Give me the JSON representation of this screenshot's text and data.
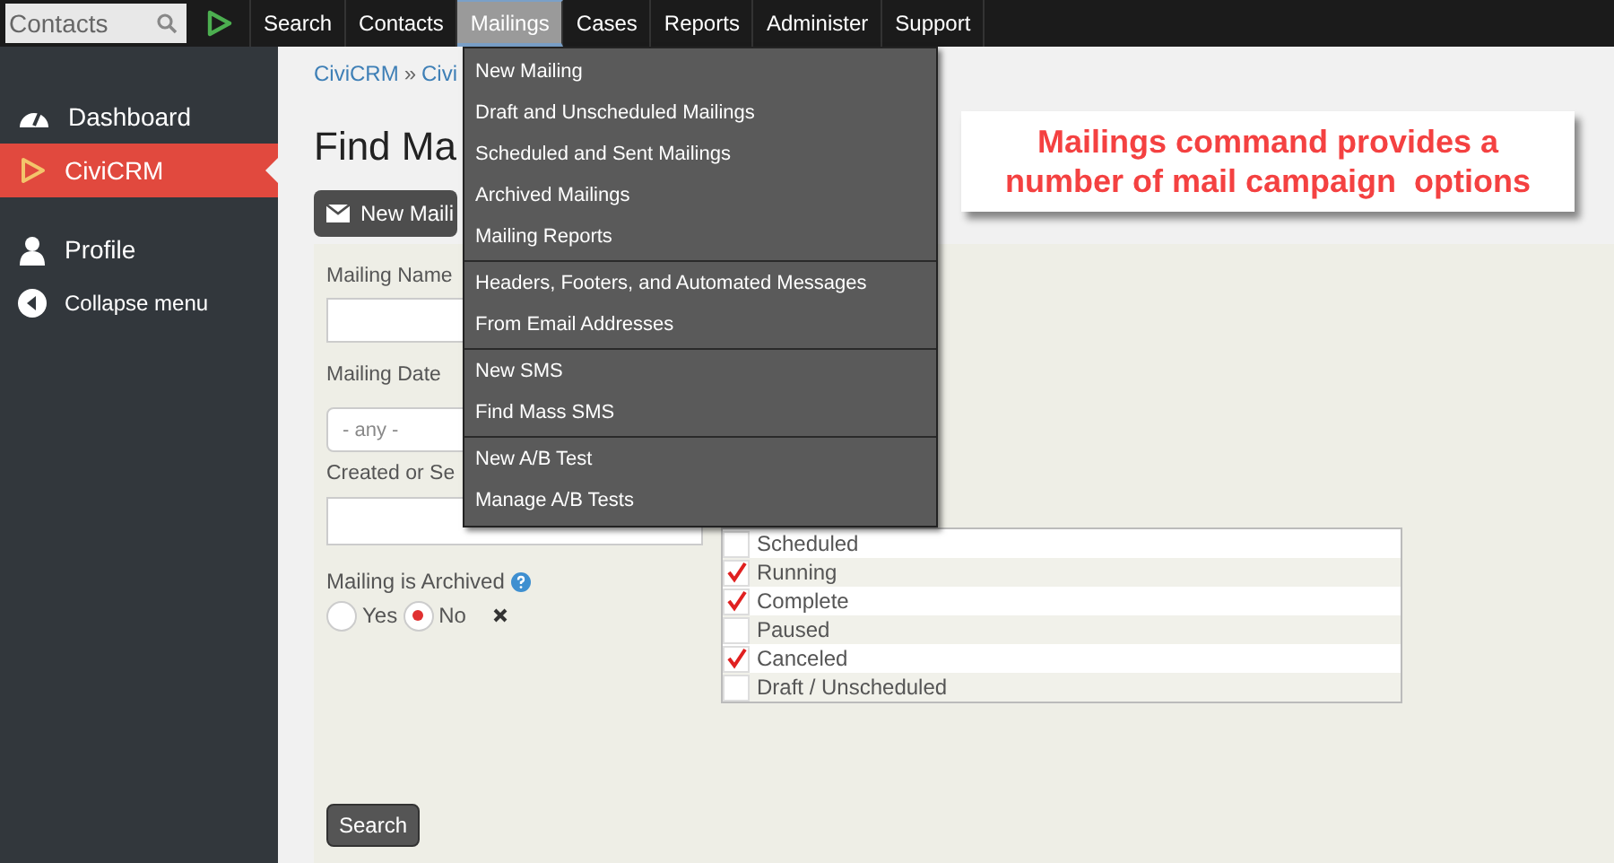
{
  "topbar": {
    "search": {
      "placeholder": "Contacts"
    },
    "nav": [
      {
        "label": "Search",
        "selected": false
      },
      {
        "label": "Contacts",
        "selected": false
      },
      {
        "label": "Mailings",
        "selected": true
      },
      {
        "label": "Cases",
        "selected": false
      },
      {
        "label": "Reports",
        "selected": false
      },
      {
        "label": "Administer",
        "selected": false
      },
      {
        "label": "Support",
        "selected": false
      }
    ]
  },
  "sidebar": {
    "items": [
      {
        "label": "Dashboard",
        "kind": "dashboard",
        "selected": false
      },
      {
        "label": "CiviCRM",
        "kind": "civicrm",
        "selected": true
      },
      {
        "label": "Profile",
        "kind": "profile",
        "selected": false
      },
      {
        "label": "Collapse menu",
        "kind": "collapse",
        "selected": false
      }
    ]
  },
  "page": {
    "breadcrumb": [
      {
        "label": "CiviCRM"
      },
      {
        "label": "Civi"
      }
    ],
    "breadcrumb_separator": "»",
    "title": "Find Ma",
    "new_button": "New Maili",
    "fields": [
      {
        "label": "Mailing Name",
        "kind": "input"
      },
      {
        "label": "Mailing Date",
        "kind": "select",
        "value": "- any -"
      },
      {
        "label": "Created or Se",
        "kind": "wide-input"
      }
    ],
    "archived": {
      "label": "Mailing is Archived",
      "options": [
        {
          "label": "Yes",
          "selected": false
        },
        {
          "label": "No",
          "selected": true
        }
      ]
    },
    "statuses": [
      {
        "label": "Scheduled",
        "checked": false
      },
      {
        "label": "Running",
        "checked": true
      },
      {
        "label": "Complete",
        "checked": true
      },
      {
        "label": "Paused",
        "checked": false
      },
      {
        "label": "Canceled",
        "checked": true
      },
      {
        "label": "Draft / Unscheduled",
        "checked": false
      }
    ],
    "search_button": "Search"
  },
  "dropdown": {
    "groups": [
      [
        "New Mailing",
        "Draft and Unscheduled Mailings",
        "Scheduled and Sent Mailings",
        "Archived Mailings",
        "Mailing Reports"
      ],
      [
        "Headers, Footers, and Automated Messages",
        "From Email Addresses"
      ],
      [
        "New SMS",
        "Find Mass SMS"
      ],
      [
        "New A/B Test",
        "Manage A/B Tests"
      ]
    ]
  },
  "callout": {
    "text": "Mailings command provides a number of mail campaign  options"
  }
}
